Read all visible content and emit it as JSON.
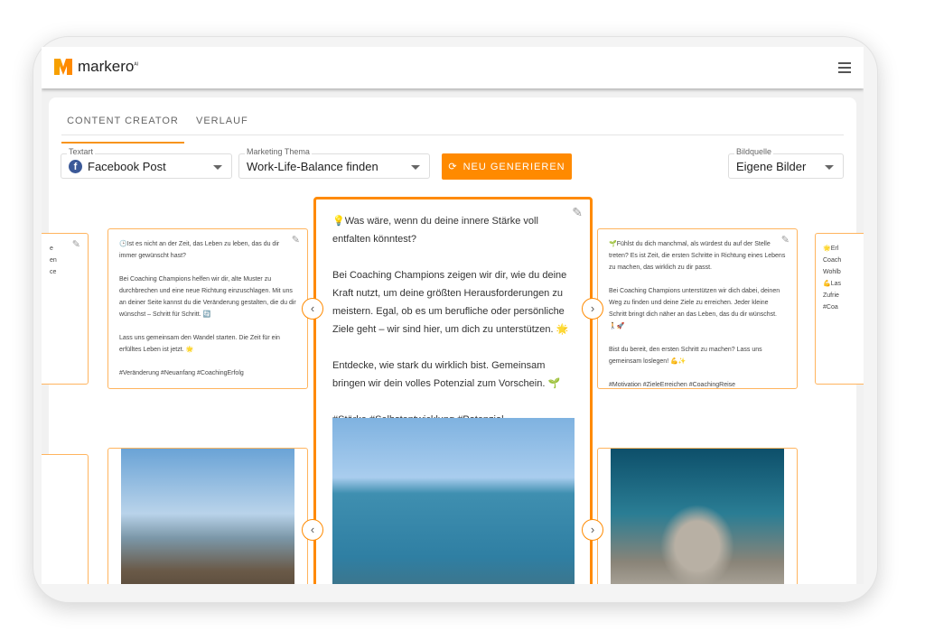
{
  "app": {
    "logo": "markero",
    "logo_sup": "AI"
  },
  "tabs": [
    {
      "label": "CONTENT CREATOR",
      "active": true
    },
    {
      "label": "VERLAUF",
      "active": false
    }
  ],
  "controls": {
    "textart": {
      "label": "Textart",
      "value": "Facebook Post",
      "icon": "facebook-icon"
    },
    "thema": {
      "label": "Marketing Thema",
      "value": "Work-Life-Balance finden"
    },
    "generate": {
      "label": "NEU GENERIEREN",
      "icon": "refresh-icon"
    },
    "bildquelle": {
      "label": "Bildquelle",
      "value": "Eigene Bilder"
    }
  },
  "colors": {
    "accent": "#ff8a00"
  },
  "posts": {
    "far_left": {
      "text": "e\nen\nce"
    },
    "left": {
      "p1": "🕒Ist es nicht an der Zeit, das Leben zu leben, das du dir immer gewünscht hast?",
      "p2": "Bei Coaching Champions helfen wir dir, alte Muster zu durchbrechen und eine neue Richtung einzuschlagen. Mit uns an deiner Seite kannst du die Veränderung gestalten, die du dir wünschst – Schritt für Schritt. 🔄",
      "p3": "Lass uns gemeinsam den Wandel starten. Die Zeit für ein erfülltes Leben ist jetzt. 🌟",
      "tags": "#Veränderung #Neuanfang #CoachingErfolg"
    },
    "center": {
      "p1": "💡Was wäre, wenn du deine innere Stärke voll entfalten könntest?",
      "p2": "Bei Coaching Champions zeigen wir dir, wie du deine Kraft nutzt, um deine größten Herausforderungen zu meistern. Egal, ob es um berufliche oder persönliche Ziele geht – wir sind hier, um dich zu unterstützen. 🌟",
      "p3": "Entdecke, wie stark du wirklich bist. Gemeinsam bringen wir dein volles Potenzial zum Vorschein. 🌱",
      "tags": "#Stärke #Selbstentwicklung #Potenzial"
    },
    "right": {
      "p1": "🌱Fühlst du dich manchmal, als würdest du auf der Stelle treten? Es ist Zeit, die ersten Schritte in Richtung eines Lebens zu machen, das wirklich zu dir passt.",
      "p2": "Bei Coaching Champions unterstützen wir dich dabei, deinen Weg zu finden und deine Ziele zu erreichen. Jeder kleine Schritt bringt dich näher an das Leben, das du dir wünschst. 🚶🚀",
      "p3": "Bist du bereit, den ersten Schritt zu machen? Lass uns gemeinsam loslegen! 💪✨",
      "tags": "#Motivation #ZieleErreichen #CoachingReise"
    },
    "far_right": {
      "text": "🌟Erl\nCoach\nWohlb\n💪Las\nZufrie\n#Coa"
    }
  }
}
